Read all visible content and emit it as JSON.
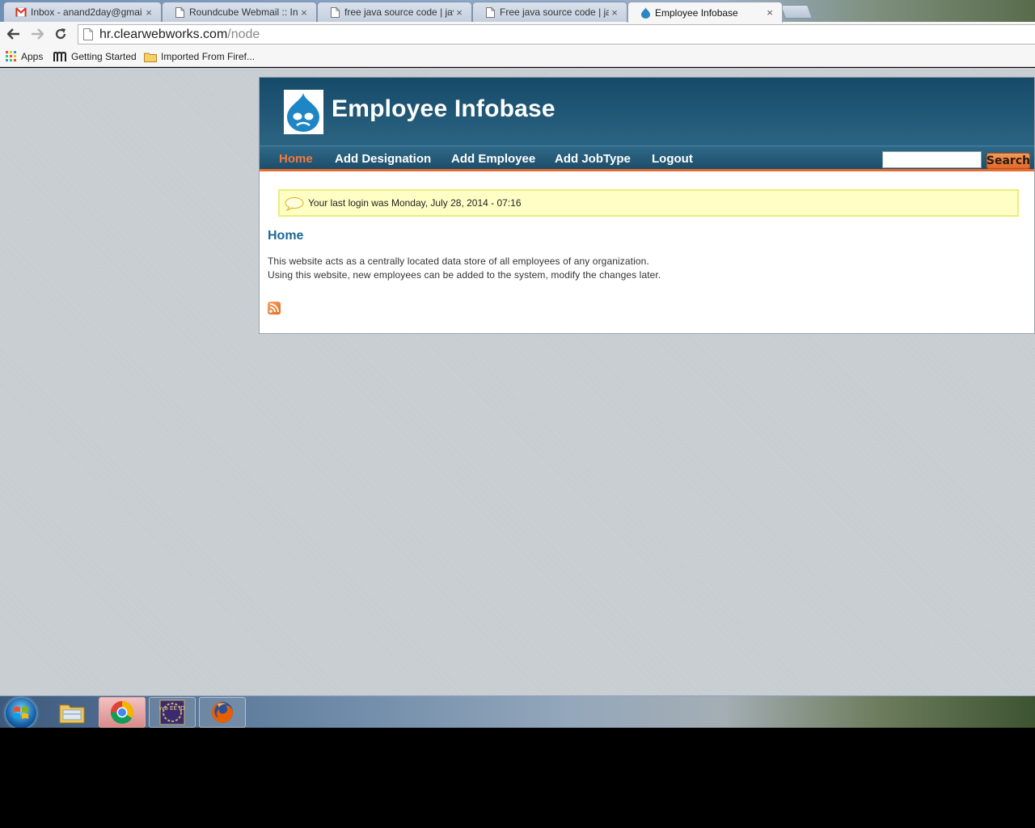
{
  "browser": {
    "tabs": [
      {
        "title": "Inbox - anand2day@gmai",
        "icon": "gmail-icon",
        "active": false
      },
      {
        "title": "Roundcube Webmail :: Int",
        "icon": "page-icon",
        "active": false
      },
      {
        "title": "free java source code | jav",
        "icon": "page-icon",
        "active": false
      },
      {
        "title": "Free java source code | jav",
        "icon": "page-icon",
        "active": false
      },
      {
        "title": "Employee Infobase",
        "icon": "drupal-icon",
        "active": true
      }
    ],
    "close_glyph": "×",
    "url_host": "hr.clearwebworks.com",
    "url_path": "/node",
    "bookmarks": [
      {
        "label": "Apps",
        "icon": "apps-grid-icon"
      },
      {
        "label": "Getting Started",
        "icon": "m-icon"
      },
      {
        "label": "Imported From Firef...",
        "icon": "folder-icon"
      }
    ]
  },
  "site": {
    "name": "Employee Infobase",
    "nav": [
      {
        "label": "Home",
        "active": true
      },
      {
        "label": "Add Designation",
        "active": false
      },
      {
        "label": "Add Employee",
        "active": false
      },
      {
        "label": "Add JobType",
        "active": false
      },
      {
        "label": "Logout",
        "active": false
      }
    ],
    "search": {
      "value": "",
      "button_label": "Search"
    },
    "status_message": "Your last login was Monday, July 28, 2014 - 07:16",
    "page_title": "Home",
    "body_lines": [
      "This website acts as a centrally located data store of all employees of any organization.",
      "Using this website, new employees can be added to the system, modify the changes later."
    ],
    "feed_icon": "rss-icon"
  },
  "taskbar": {
    "items": [
      {
        "name": "windows-explorer",
        "icon": "folder-icon"
      },
      {
        "name": "google-chrome",
        "icon": "chrome-icon"
      },
      {
        "name": "java-ee-ide",
        "icon": "java-ee-ide-icon",
        "label": "Java EE IDE"
      },
      {
        "name": "firefox",
        "icon": "firefox-icon"
      }
    ]
  },
  "colors": {
    "header_dark": "#164a69",
    "nav_active": "#f07a3e",
    "accent_orange": "#e86b2f",
    "title_blue": "#1e6a96",
    "status_bg": "#ffffc5"
  }
}
